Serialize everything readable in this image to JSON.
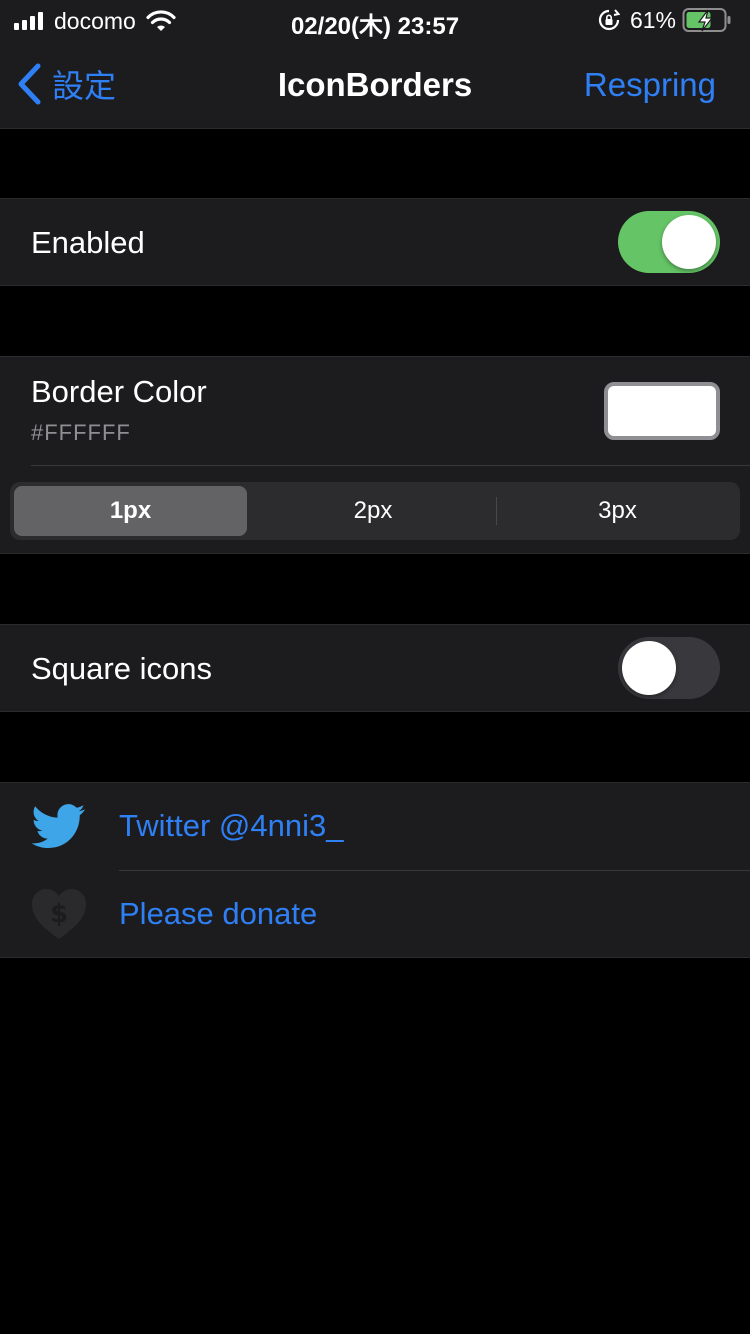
{
  "status_bar": {
    "carrier": "docomo",
    "time": "02/20(木) 23:57",
    "battery_percent": "61%"
  },
  "nav": {
    "back_label": "設定",
    "title": "IconBorders",
    "right_button": "Respring"
  },
  "enabled": {
    "label": "Enabled",
    "on": true
  },
  "border_color": {
    "label": "Border Color",
    "hex": "#FFFFFF",
    "swatch_color": "#FFFFFF"
  },
  "border_width": {
    "options": [
      "1px",
      "2px",
      "3px"
    ],
    "selected": "1px"
  },
  "square_icons": {
    "label": "Square icons",
    "on": false
  },
  "links": {
    "twitter": {
      "label": "Twitter @4nni3_",
      "icon": "twitter-bird-icon"
    },
    "donate": {
      "label": "Please donate",
      "icon": "heart-dollar-icon"
    }
  },
  "colors": {
    "accent_blue": "#2F7FF5",
    "toggle_on": "#65C466",
    "toggle_off": "#39393D",
    "twitter_blue": "#3EA5E8"
  }
}
